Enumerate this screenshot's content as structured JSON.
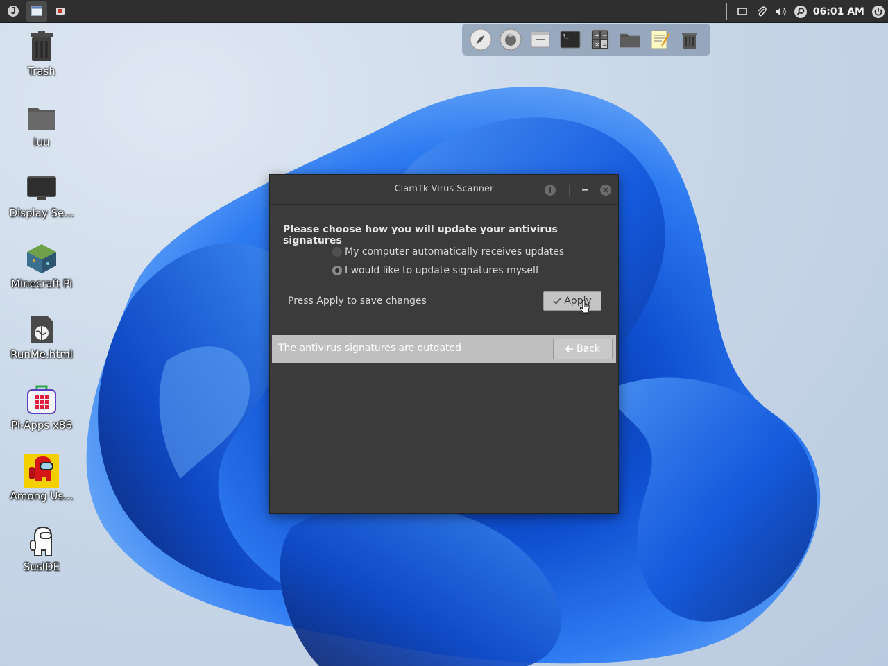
{
  "panel": {
    "clock": "06:01 AM"
  },
  "desktop_icons": [
    {
      "label": "Trash",
      "icon": "trash-icon"
    },
    {
      "label": "iuu",
      "icon": "folder-icon"
    },
    {
      "label": "Display Se...",
      "icon": "display-icon"
    },
    {
      "label": "Minecraft Pi",
      "icon": "minecraft-icon"
    },
    {
      "label": "RunMe.html",
      "icon": "html-file-icon"
    },
    {
      "label": "Pi-Apps x86",
      "icon": "pi-apps-icon"
    },
    {
      "label": "Among Us...",
      "icon": "among-us-icon"
    },
    {
      "label": "SusIDE",
      "icon": "suside-icon"
    }
  ],
  "dock_items": [
    "launcher-icon",
    "firefox-icon",
    "file-manager-icon",
    "terminal-icon",
    "calculator-icon",
    "folder-icon",
    "text-editor-icon",
    "trash-icon"
  ],
  "dialog": {
    "title": "ClamTk Virus Scanner",
    "heading": "Please choose how you will update your antivirus signatures",
    "options": [
      {
        "label": "My computer automatically receives updates",
        "selected": false
      },
      {
        "label": "I would like to update signatures myself",
        "selected": true
      }
    ],
    "save_text": "Press Apply to save changes",
    "apply_label": "Apply",
    "status_text": "The antivirus signatures are outdated",
    "back_label": "Back"
  },
  "colors": {
    "panel": "#2f2f2f",
    "dialog_bg": "#3b3b3b",
    "wallpaper_blue": "#1565e6"
  }
}
